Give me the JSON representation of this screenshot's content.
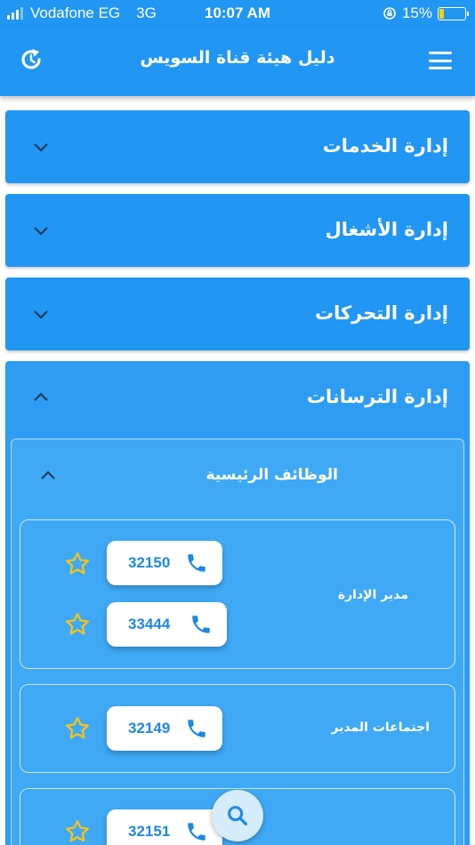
{
  "status_bar": {
    "carrier": "Vodafone EG",
    "network": "3G",
    "time": "10:07 AM",
    "battery_percent": "15%",
    "battery_level": 0.15
  },
  "app_bar": {
    "title": "دليل هيئة قناة السويس",
    "menu_icon": "hamburger-icon",
    "refresh_icon": "refresh-icon"
  },
  "departments": [
    {
      "title": "إدارة الخدمات",
      "expanded": false
    },
    {
      "title": "إدارة الأشغال",
      "expanded": false
    },
    {
      "title": "إدارة التحركات",
      "expanded": false
    },
    {
      "title": "إدارة الترسانات",
      "expanded": true
    }
  ],
  "section": {
    "title": "الوظائف الرئيسية",
    "entries": [
      {
        "role": "مدير الإدارة",
        "phones": [
          "32150",
          "33444"
        ]
      },
      {
        "role": "اجتماعات المدير",
        "phones": [
          "32149"
        ]
      },
      {
        "role": "",
        "phones": [
          "32151"
        ]
      }
    ]
  },
  "colors": {
    "primary": "#2196f3",
    "star": "#f5c518",
    "phone_text": "#1e88e5"
  },
  "fab_icon": "search-icon"
}
